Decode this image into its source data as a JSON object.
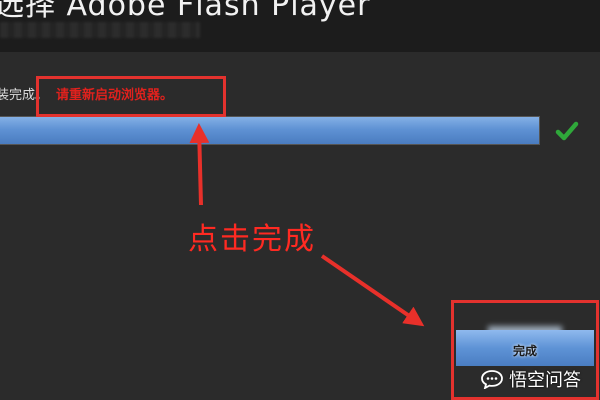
{
  "window": {
    "title": "选择 Adobe Flash Player",
    "subtitle": ""
  },
  "installer": {
    "status_prefix": "装完成。",
    "restart_notice": "请重新启动浏览器。",
    "progress_percent": 100,
    "finish_button_label": "完成"
  },
  "annotation": {
    "callout_text": "点击完成"
  },
  "watermark": {
    "text": "悟空问答"
  },
  "icons": {
    "check": "check-icon",
    "watermark_logo": "chat-bubble-icon"
  },
  "colors": {
    "background": "#2b2b2b",
    "header": "#1c1c1c",
    "progress_blue": "#5f92d4",
    "check_green": "#2fa83a",
    "annotation_red": "#e3322e",
    "restart_red": "#e0211d"
  }
}
